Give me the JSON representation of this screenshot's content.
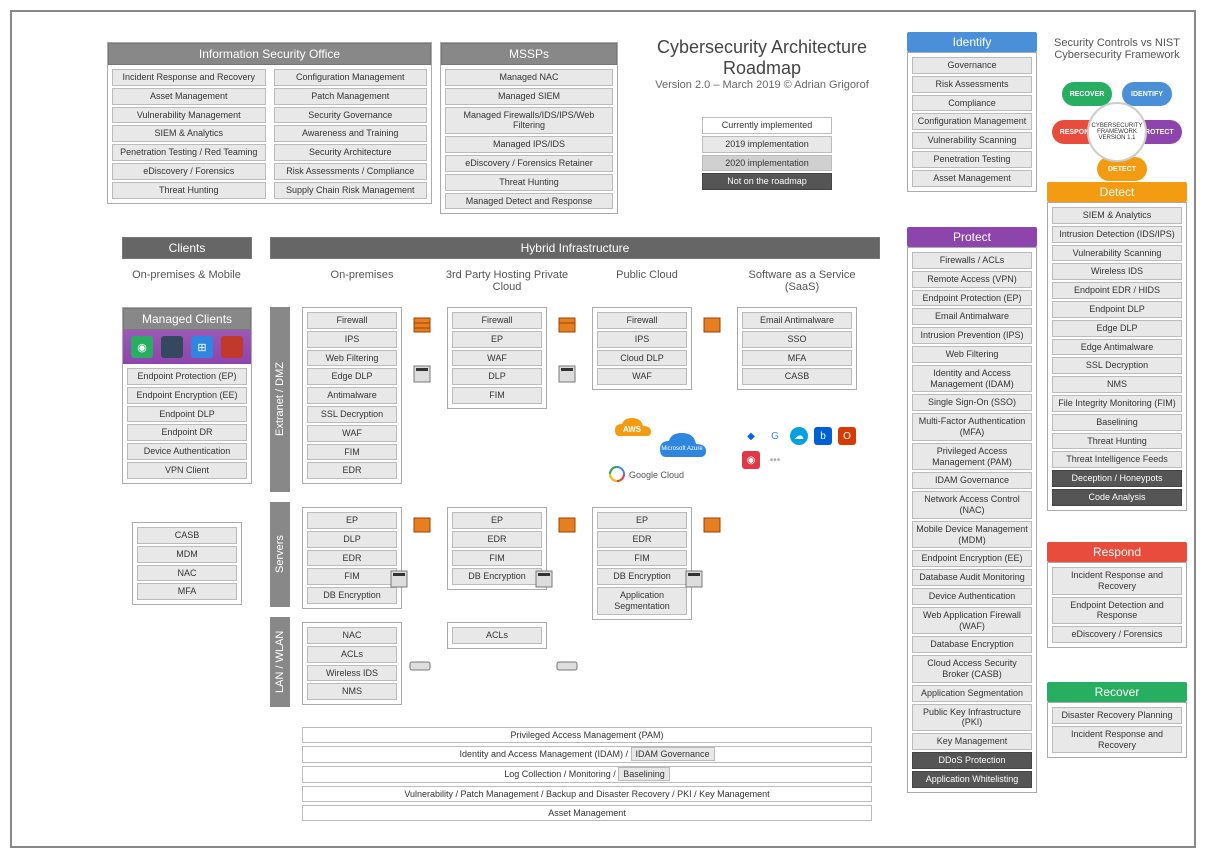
{
  "title": "Cybersecurity Architecture Roadmap",
  "subtitle": "Version 2.0 – March 2019 ©  Adrian Grigorof",
  "legend": {
    "current": "Currently implemented",
    "y2019": "2019 implementation",
    "y2020": "2020 implementation",
    "not": "Not on the roadmap"
  },
  "iso": {
    "header": "Information Security Office",
    "left": [
      "Incident Response and Recovery",
      "Asset Management",
      "Vulnerability Management",
      "SIEM & Analytics",
      "Penetration Testing / Red Teaming",
      "eDiscovery / Forensics",
      "Threat Hunting"
    ],
    "right": [
      "Configuration Management",
      "Patch Management",
      "Security Governance",
      "Awareness and Training",
      "Security Architecture",
      "Risk Assessments / Compliance",
      "Supply Chain Risk Management"
    ]
  },
  "mssps": {
    "header": "MSSPs",
    "items": [
      "Managed NAC",
      "Managed SIEM",
      "Managed Firewalls/IDS/IPS/Web Filtering",
      "Managed IPS/IDS",
      "eDiscovery / Forensics Retainer",
      "Threat Hunting",
      "Managed Detect and Response"
    ]
  },
  "identify": {
    "header": "Identify",
    "items": [
      "Governance",
      "Risk Assessments",
      "Compliance",
      "Configuration Management",
      "Vulnerability Scanning",
      "Penetration Testing",
      "Asset Management"
    ]
  },
  "protect": {
    "header": "Protect",
    "items": [
      "Firewalls / ACLs",
      "Remote Access (VPN)",
      "Endpoint Protection (EP)",
      "Email Antimalware",
      "Intrusion Prevention (IPS)",
      "Web Filtering",
      "Identity and Access Management (IDAM)",
      "Single Sign-On (SSO)",
      "Multi-Factor Authentication (MFA)",
      "Privileged Access Management (PAM)",
      "IDAM Governance",
      "Network Access Control (NAC)",
      "Mobile Device Management (MDM)",
      "Endpoint Encryption (EE)",
      "Database Audit Monitoring",
      "Device Authentication",
      "Web Application Firewall (WAF)",
      "Database Encryption",
      "Cloud Access Security Broker (CASB)",
      "Application Segmentation",
      "Public Key Infrastructure (PKI)",
      "Key Management",
      "DDoS Protection",
      "Application Whitelisting"
    ]
  },
  "detect": {
    "header": "Detect",
    "items": [
      "SIEM & Analytics",
      "Intrusion Detection (IDS/IPS)",
      "Vulnerability Scanning",
      "Wireless IDS",
      "Endpoint EDR / HIDS",
      "Endpoint DLP",
      "Edge DLP",
      "Edge Antimalware",
      "SSL Decryption",
      "NMS",
      "File Integrity Monitoring (FIM)",
      "Baselining",
      "Threat Hunting",
      "Threat Intelligence Feeds",
      "Deception / Honeypots",
      "Code Analysis"
    ]
  },
  "respond": {
    "header": "Respond",
    "items": [
      "Incident Response and Recovery",
      "Endpoint Detection and Response",
      "eDiscovery / Forensics"
    ]
  },
  "recover": {
    "header": "Recover",
    "items": [
      "Disaster Recovery Planning",
      "Incident Response and Recovery"
    ]
  },
  "nist": {
    "title": "Security Controls vs NIST Cybersecurity Framework",
    "center": "CYBERSECURITY FRAMEWORK VERSION 1.1",
    "segments": {
      "identify": "IDENTIFY",
      "protect": "PROTECT",
      "detect": "DETECT",
      "respond": "RESPOND",
      "recover": "RECOVER"
    }
  },
  "clients": {
    "header": "Clients",
    "subhead": "On-premises & Mobile",
    "managed_header": "Managed Clients",
    "managed_items": [
      "Endpoint Protection (EP)",
      "Endpoint Encryption (EE)",
      "Endpoint DLP",
      "Endpoint DR",
      "Device Authentication",
      "VPN Client"
    ],
    "extra": [
      "CASB",
      "MDM",
      "NAC",
      "MFA"
    ]
  },
  "hybrid": {
    "header": "Hybrid Infrastructure",
    "cols": {
      "onprem": "On-premises",
      "third": "3rd Party Hosting Private Cloud",
      "public": "Public Cloud",
      "saas": "Software as a Service (SaaS)"
    }
  },
  "vlabels": {
    "dmz": "Extranet / DMZ",
    "servers": "Servers",
    "lan": "LAN / WLAN"
  },
  "dmz": {
    "onprem": [
      "Firewall",
      "IPS",
      "Web Filtering",
      "Edge DLP",
      "Antimalware",
      "SSL Decryption",
      "WAF",
      "FIM",
      "EDR"
    ],
    "third": [
      "Firewall",
      "EP",
      "WAF",
      "DLP",
      "FIM"
    ],
    "public": [
      "Firewall",
      "IPS",
      "Cloud DLP",
      "WAF"
    ],
    "saas": [
      "Email Antimalware",
      "SSO",
      "MFA",
      "CASB"
    ]
  },
  "servers": {
    "onprem": [
      "EP",
      "DLP",
      "EDR",
      "FIM",
      "DB Encryption"
    ],
    "third": [
      "EP",
      "EDR",
      "FIM",
      "DB Encryption"
    ],
    "public": [
      "EP",
      "EDR",
      "FIM",
      "DB Encryption",
      "Application Segmentation"
    ]
  },
  "lan": {
    "onprem": [
      "NAC",
      "ACLs",
      "Wireless IDS",
      "NMS"
    ],
    "third": [
      "ACLs"
    ]
  },
  "clouds": {
    "aws": "AWS",
    "azure": "Microsoft Azure",
    "gcp": "Google Cloud"
  },
  "footer": {
    "pam": "Privileged Access Management (PAM)",
    "idam": "Identity and Access Management (IDAM) /",
    "idam_gov": "IDAM Governance",
    "log": "Log Collection / Monitoring /",
    "baselining": "Baselining",
    "vuln": "Vulnerability / Patch Management / Backup and Disaster Recovery / PKI / Key Management",
    "asset": "Asset Management"
  }
}
